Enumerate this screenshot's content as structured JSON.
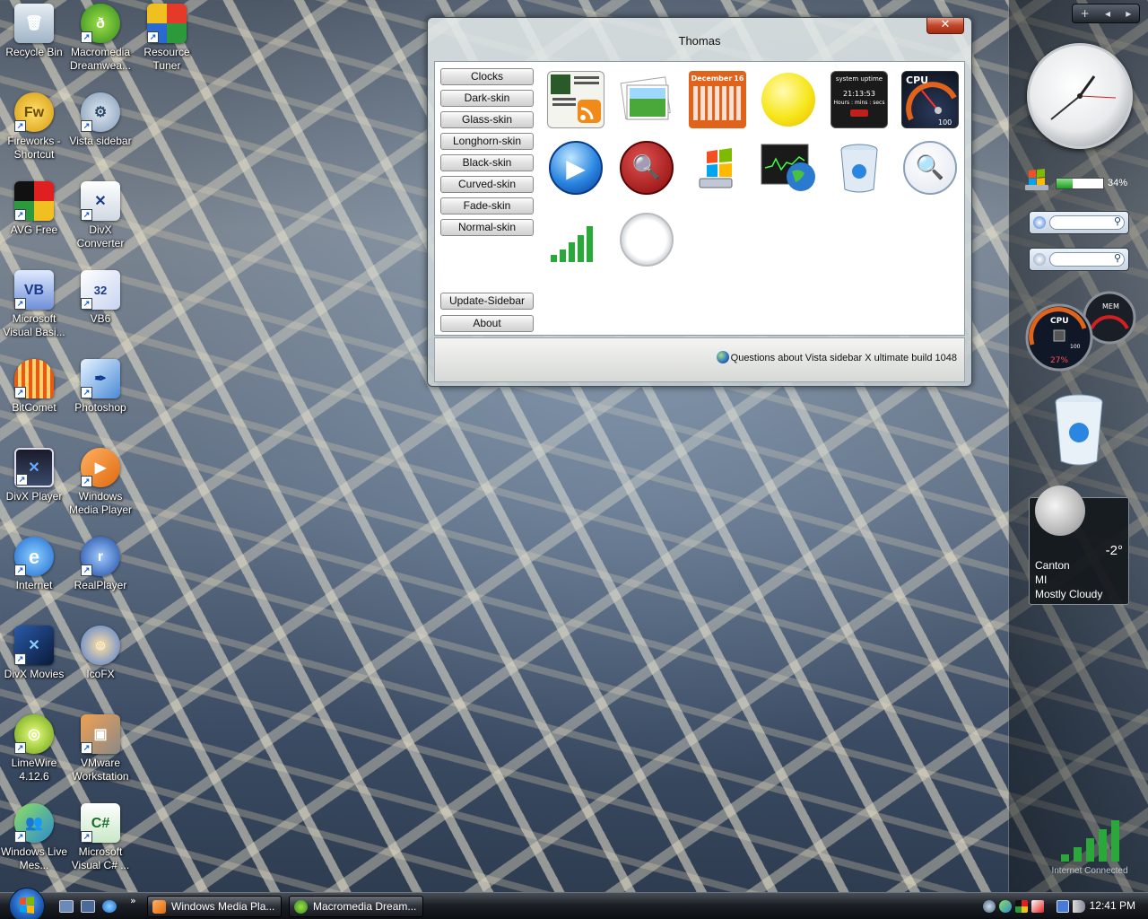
{
  "desktop": {
    "icons": [
      {
        "label": "Recycle Bin"
      },
      {
        "label": "Macromedia Dreamwea..."
      },
      {
        "label": "Resource Tuner"
      },
      {
        "label": "Fireworks - Shortcut"
      },
      {
        "label": "Vista sidebar"
      },
      {
        "label": "AVG Free"
      },
      {
        "label": "DivX Converter"
      },
      {
        "label": "Microsoft Visual Basi..."
      },
      {
        "label": "VB6"
      },
      {
        "label": "BitComet"
      },
      {
        "label": "Photoshop"
      },
      {
        "label": "DivX Player"
      },
      {
        "label": "Windows Media Player"
      },
      {
        "label": "Internet"
      },
      {
        "label": "RealPlayer"
      },
      {
        "label": "DivX Movies"
      },
      {
        "label": "IcoFX"
      },
      {
        "label": "LimeWire 4.12.6"
      },
      {
        "label": "VMware Workstation"
      },
      {
        "label": "Windows Live Mes..."
      },
      {
        "label": "Microsoft Visual C# ..."
      }
    ]
  },
  "dialog": {
    "title": "Thomas",
    "close_label": "✕",
    "skins": [
      "Clocks",
      "Dark-skin",
      "Glass-skin",
      "Longhorn-skin",
      "Black-skin",
      "Curved-skin",
      "Fade-skin",
      "Normal-skin"
    ],
    "update_label": "Update-Sidebar",
    "about_label": "About",
    "status_text": "Questions about Vista sidebar X ultimate build 1048",
    "gadget_text": {
      "calendar_month": "December",
      "calendar_day": "16",
      "uptime_title": "system uptime",
      "uptime_value": "21:13:53",
      "uptime_units": "Hours : mins : secs",
      "cpu_label": "CPU",
      "cpu_max": "100"
    }
  },
  "sidebar": {
    "toolbar": {
      "add": "+",
      "prev": "◂",
      "next": "▸"
    },
    "meter_percent": "34%",
    "meter_fill": 0.34,
    "cpu_label": "CPU",
    "cpu_value": "27%",
    "mem_label": "MEM",
    "gauge_max": "100",
    "weather": {
      "temp": "-2°",
      "city": "Canton",
      "state": "MI",
      "condition": "Mostly Cloudy"
    },
    "network_label": "Internet Connected"
  },
  "taskbar": {
    "tasks": [
      {
        "label": "Windows Media Pla..."
      },
      {
        "label": "Macromedia Dream..."
      }
    ],
    "overflow": "»",
    "clock": "12:41 PM"
  },
  "colors": {
    "accent": "#1f9a23",
    "close_red": "#c0452b",
    "calendar_orange": "#e0631c"
  }
}
